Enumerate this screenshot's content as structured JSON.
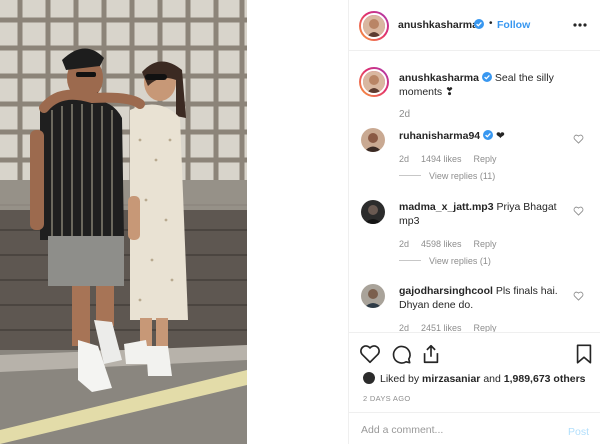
{
  "header": {
    "username": "anushkasharma",
    "separator": "•",
    "follow_label": "Follow"
  },
  "caption": {
    "username": "anushkasharma",
    "text": "Seal the silly moments ❣",
    "time": "2d"
  },
  "comments": [
    {
      "username": "ruhanisharma94",
      "text": "❤",
      "time": "2d",
      "likes": "1494 likes",
      "reply": "Reply",
      "view_replies": "View replies (11)"
    },
    {
      "username": "madma_x_jatt.mp3",
      "text": "Priya Bhagat mp3",
      "time": "2d",
      "likes": "4598 likes",
      "reply": "Reply",
      "view_replies": "View replies (1)"
    },
    {
      "username": "gajodharsinghcool",
      "text": "Pls finals hai. Dhyan dene do.",
      "time": "2d",
      "likes": "2451 likes",
      "reply": "Reply"
    }
  ],
  "actions": {
    "liked_prefix": "Liked by",
    "liked_user": "mirzasaniar",
    "liked_and": "and",
    "liked_count": "1,989,673 others",
    "posted_ago": "2 DAYS AGO"
  },
  "add_comment": {
    "placeholder": "Add a comment...",
    "post_label": "Post"
  },
  "colors": {
    "link_blue": "#3897f0",
    "post_disabled": "#b2dffc",
    "verified": "#3897f0",
    "secondary_text": "#8e8e8e"
  },
  "icons": {
    "heart": "heart-icon",
    "comment": "comment-bubble-icon",
    "share": "share-icon",
    "save": "bookmark-icon",
    "more": "more-options-icon",
    "verified": "verified-badge-icon"
  }
}
